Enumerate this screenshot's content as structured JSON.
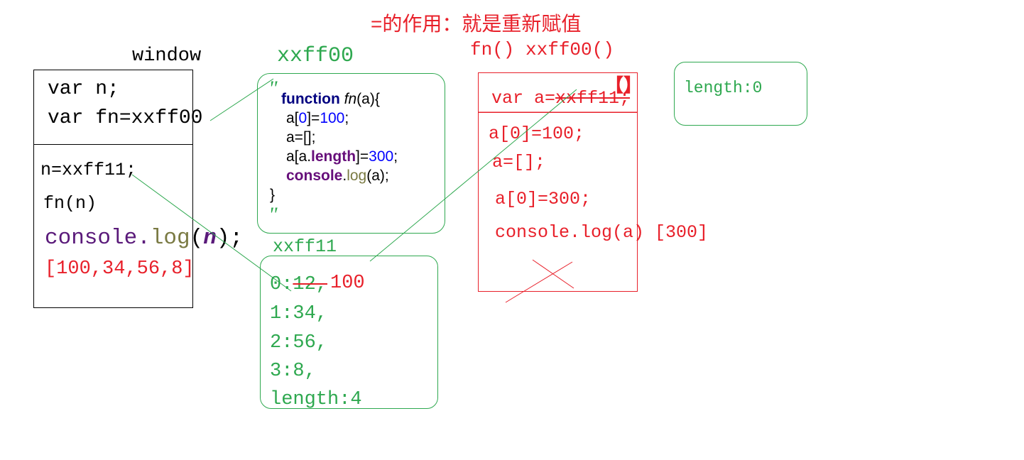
{
  "title": "=的作用：就是重新赋值",
  "window": {
    "label": "window",
    "vars": [
      "var n;",
      "var fn=xxff00"
    ],
    "code": [
      "n=xxff11;",
      "fn(n)"
    ],
    "console_obj": "console.",
    "console_log": "log",
    "console_paren_open": "(",
    "console_arg": "n",
    "console_paren_close": ");",
    "output": "[100,34,56,8]"
  },
  "heap_fn": {
    "label": "xxff00",
    "quote_open": "\"",
    "kw_function": "function",
    "fn_name": "fn",
    "fn_params": "(a){",
    "l1_a": "a[",
    "l1_idx": "0",
    "l1_b": "]=",
    "l1_val": "100",
    "l1_c": ";",
    "l2": "a=[];",
    "l3_a": "a[a.",
    "l3_prop": "length",
    "l3_b": "]=",
    "l3_val": "300",
    "l3_c": ";",
    "l4_obj": "console",
    "l4_dot": ".",
    "l4_log": "log",
    "l4_rest": "(a);",
    "close": "}",
    "quote_close": "\""
  },
  "heap_arr": {
    "label": "xxff11",
    "item0_prefix": "0:",
    "item0_old": "12,",
    "item0_new": "100",
    "items": [
      "1:34,",
      "2:56,",
      "3:8,",
      "length:4"
    ]
  },
  "exec_ctx": {
    "label": "fn() xxff00()",
    "header_prefix": "var a=",
    "header_old": "xxff11;",
    "bracket_mark": "【】",
    "lines": [
      "a[0]=100;",
      "a=[];",
      "a[0]=300;",
      "console.log(a)"
    ],
    "output": "[300]"
  },
  "new_arr": {
    "item": "length:0"
  },
  "colors": {
    "green": "#2ea84f",
    "red": "#e8202a",
    "black": "#000000",
    "purple": "#5a1a7a"
  }
}
